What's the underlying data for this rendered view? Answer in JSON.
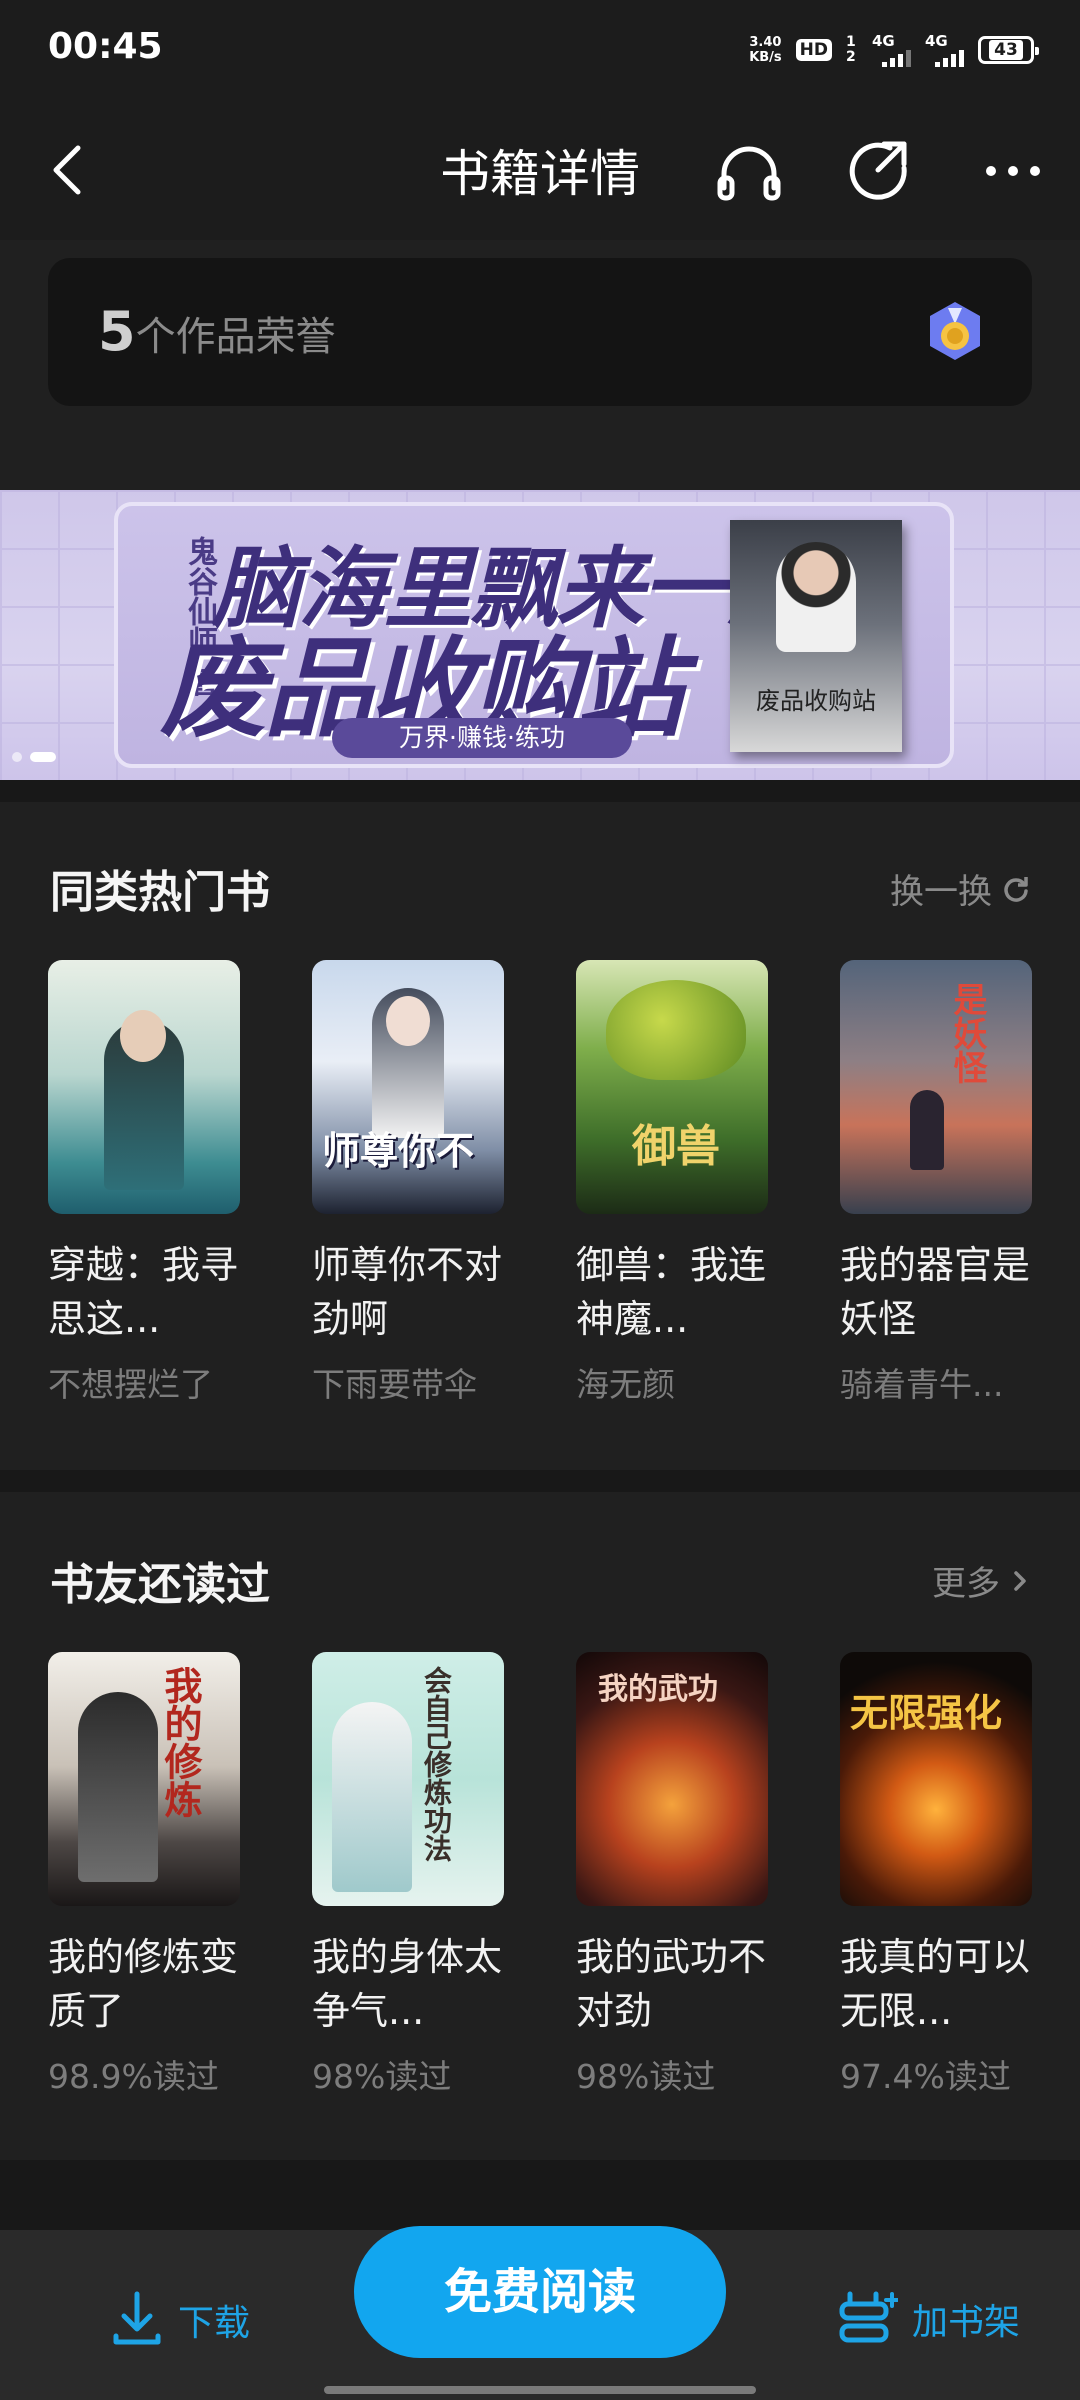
{
  "status_bar": {
    "time": "00:45",
    "net_speed_value": "3.40",
    "net_speed_unit": "KB/s",
    "hd_label": "HD",
    "hd_sub": "1 2",
    "sig1_label": "4G",
    "sig2_label": "4G",
    "battery": "43"
  },
  "nav": {
    "title": "书籍详情",
    "icons": [
      "back-icon",
      "headphones-icon",
      "share-icon",
      "more-icon"
    ]
  },
  "honor": {
    "count": "5",
    "label": "个作品荣誉"
  },
  "banner": {
    "author": "鬼谷仙师 著",
    "line1": "脑海里飘来一座",
    "line2": "废品收购站",
    "slogan": "万界·赚钱·练功",
    "cover_title": "废品收购站"
  },
  "similar": {
    "title": "同类热门书",
    "action": "换一换",
    "books": [
      {
        "title": "穿越：我寻思这...",
        "author": "不想摆烂了"
      },
      {
        "title": "师尊你不对劲啊",
        "author": "下雨要带伞"
      },
      {
        "title": "御兽：我连神魔...",
        "author": "海无颜"
      },
      {
        "title": "我的器官是妖怪",
        "author": "骑着青牛..."
      }
    ]
  },
  "also_read": {
    "title": "书友还读过",
    "action": "更多",
    "books": [
      {
        "title": "我的修炼变质了",
        "rate": "98.9%读过"
      },
      {
        "title": "我的身体太争气...",
        "rate": "98%读过"
      },
      {
        "title": "我的武功不对劲",
        "rate": "98%读过"
      },
      {
        "title": "我真的可以无限...",
        "rate": "97.4%读过"
      }
    ]
  },
  "bottom": {
    "download": "下载",
    "read": "免费阅读",
    "shelf": "加书架"
  },
  "colors": {
    "accent": "#12a6ef",
    "link": "#1ea4e6",
    "background": "#202020"
  }
}
